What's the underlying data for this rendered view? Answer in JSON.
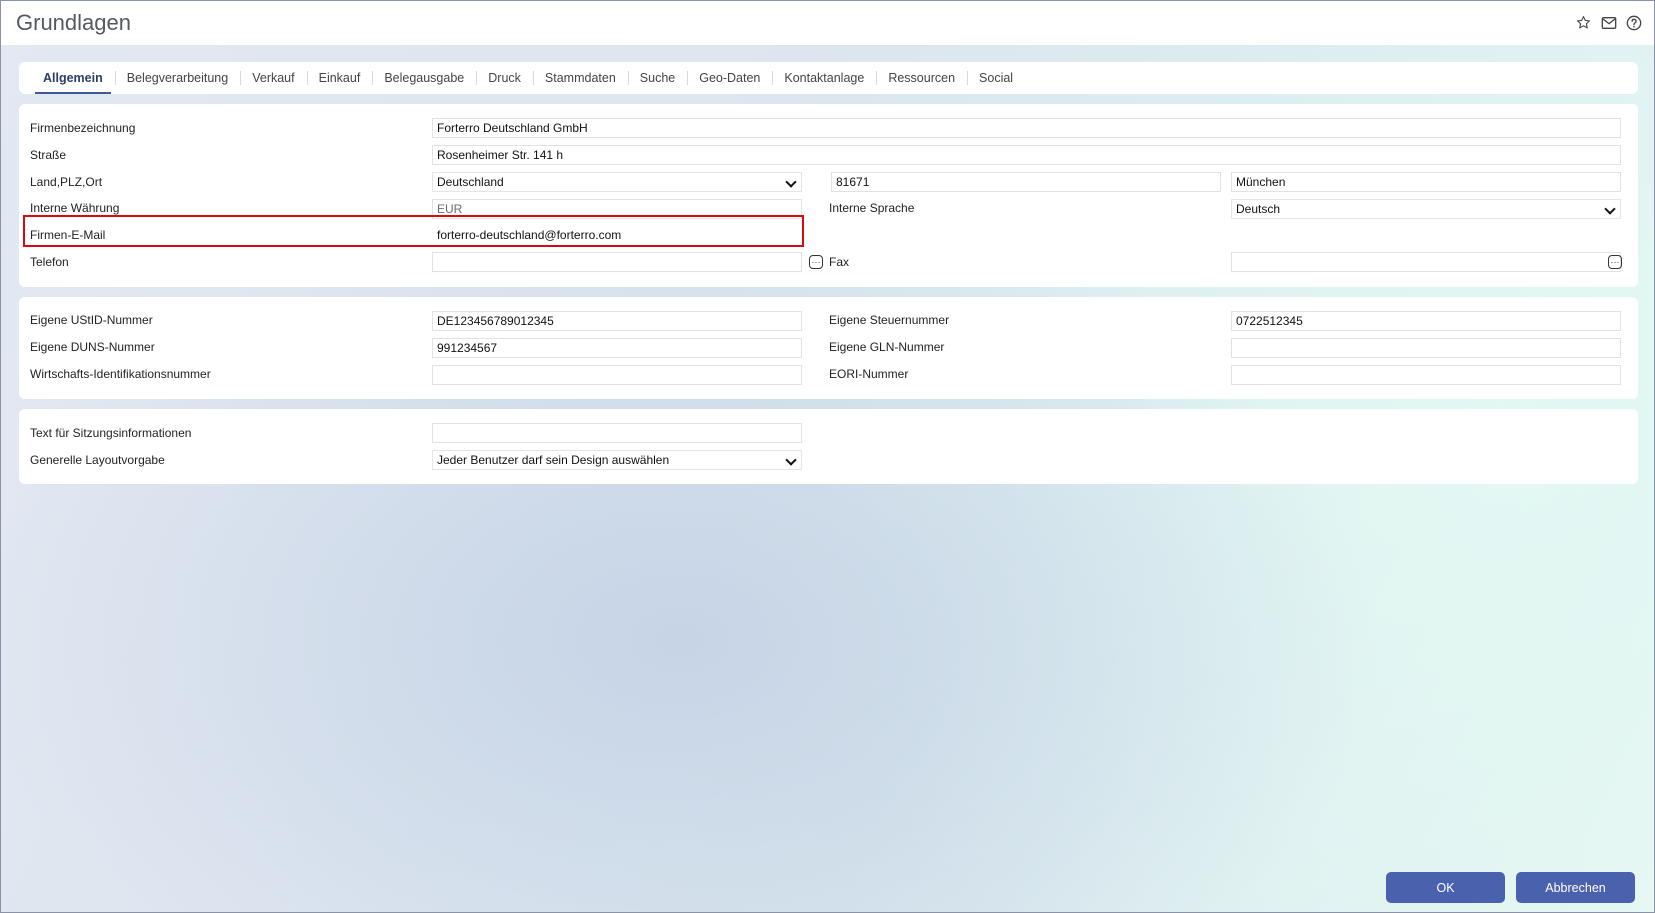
{
  "window": {
    "title": "Grundlagen"
  },
  "title_icons": [
    "star-icon",
    "mail-icon",
    "help-icon"
  ],
  "tabs": [
    {
      "label": "Allgemein",
      "active": true
    },
    {
      "label": "Belegverarbeitung"
    },
    {
      "label": "Verkauf"
    },
    {
      "label": "Einkauf"
    },
    {
      "label": "Belegausgabe"
    },
    {
      "label": "Druck"
    },
    {
      "label": "Stammdaten"
    },
    {
      "label": "Suche"
    },
    {
      "label": "Geo-Daten"
    },
    {
      "label": "Kontaktanlage"
    },
    {
      "label": "Ressourcen"
    },
    {
      "label": "Social"
    }
  ],
  "company": {
    "name_label": "Firmenbezeichnung",
    "name_value": "Forterro Deutschland GmbH",
    "street_label": "Straße",
    "street_value": "Rosenheimer Str. 141 h",
    "location_label": "Land,PLZ,Ort",
    "country_value": "Deutschland",
    "zip_value": "81671",
    "city_value": "München",
    "currency_label": "Interne Währung",
    "currency_value": "EUR",
    "language_label": "Interne Sprache",
    "language_value": "Deutsch",
    "email_label": "Firmen-E-Mail",
    "email_value": "forterro-deutschland@forterro.com",
    "phone_label": "Telefon",
    "phone_value": "",
    "fax_label": "Fax",
    "fax_value": "",
    "more_glyph": "···"
  },
  "ids": {
    "vat_label": "Eigene UStID-Nummer",
    "vat_value": "DE123456789012345",
    "tax_label": "Eigene Steuernummer",
    "tax_value": "0722512345",
    "duns_label": "Eigene DUNS-Nummer",
    "duns_value": "991234567",
    "gln_label": "Eigene GLN-Nummer",
    "gln_value": "",
    "wid_label": "Wirtschafts-Identifikationsnummer",
    "wid_value": "",
    "eori_label": "EORI-Nummer",
    "eori_value": ""
  },
  "session": {
    "text_label": "Text für Sitzungsinformationen",
    "text_value": "",
    "layout_label": "Generelle Layoutvorgabe",
    "layout_value": "Jeder Benutzer darf sein Design auswählen"
  },
  "footer": {
    "ok_label": "OK",
    "cancel_label": "Abbrechen"
  },
  "colors": {
    "accent": "#4a62ad",
    "highlight": "#d60b12",
    "active_tab": "#2b3f66"
  }
}
